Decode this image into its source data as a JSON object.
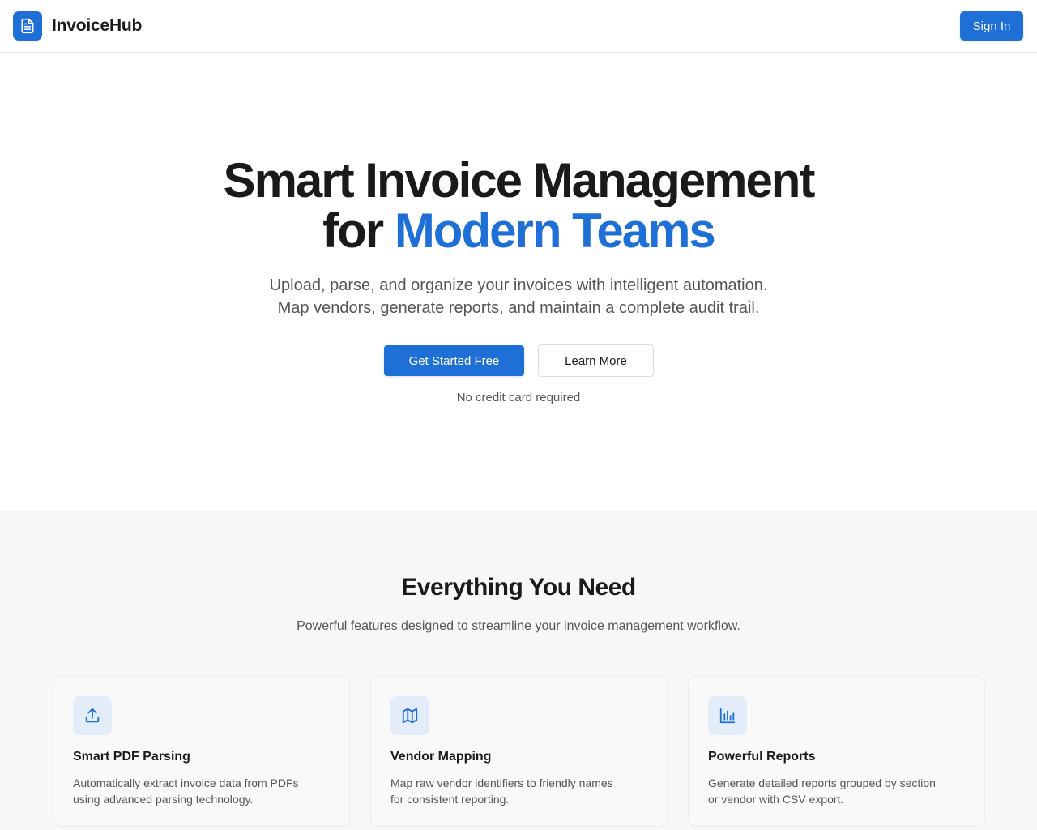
{
  "header": {
    "brand_name": "InvoiceHub",
    "brand_icon": "document-icon",
    "signin_label": "Sign In"
  },
  "hero": {
    "title_line1": "Smart Invoice Management",
    "title_line2_prefix": "for",
    "title_line2_accent": "Modern Teams",
    "subtitle_line1": "Upload, parse, and organize your invoices with intelligent automation.",
    "subtitle_line2": "Map vendors, generate reports, and maintain a complete audit trail.",
    "primary_cta": "Get Started Free",
    "secondary_cta": "Learn More",
    "note": "No credit card required"
  },
  "features": {
    "title": "Everything You Need",
    "subtitle": "Powerful features designed to streamline your invoice management workflow.",
    "items": [
      {
        "icon": "upload-icon",
        "title": "Smart PDF Parsing",
        "desc_line1": "Automatically extract invoice data from PDFs",
        "desc_line2": "using advanced parsing technology."
      },
      {
        "icon": "map-icon",
        "title": "Vendor Mapping",
        "desc_line1": "Map raw vendor identifiers to friendly names",
        "desc_line2": "for consistent reporting."
      },
      {
        "icon": "bar-chart-icon",
        "title": "Powerful Reports",
        "desc_line1": "Generate detailed reports grouped by section",
        "desc_line2": "or vendor with CSV export."
      }
    ]
  },
  "colors": {
    "accent": "#1e6fd6",
    "text": "#1a1a1a",
    "muted": "#555555",
    "section_bg": "#f7f7f7",
    "icon_bg": "#e3edf9"
  }
}
